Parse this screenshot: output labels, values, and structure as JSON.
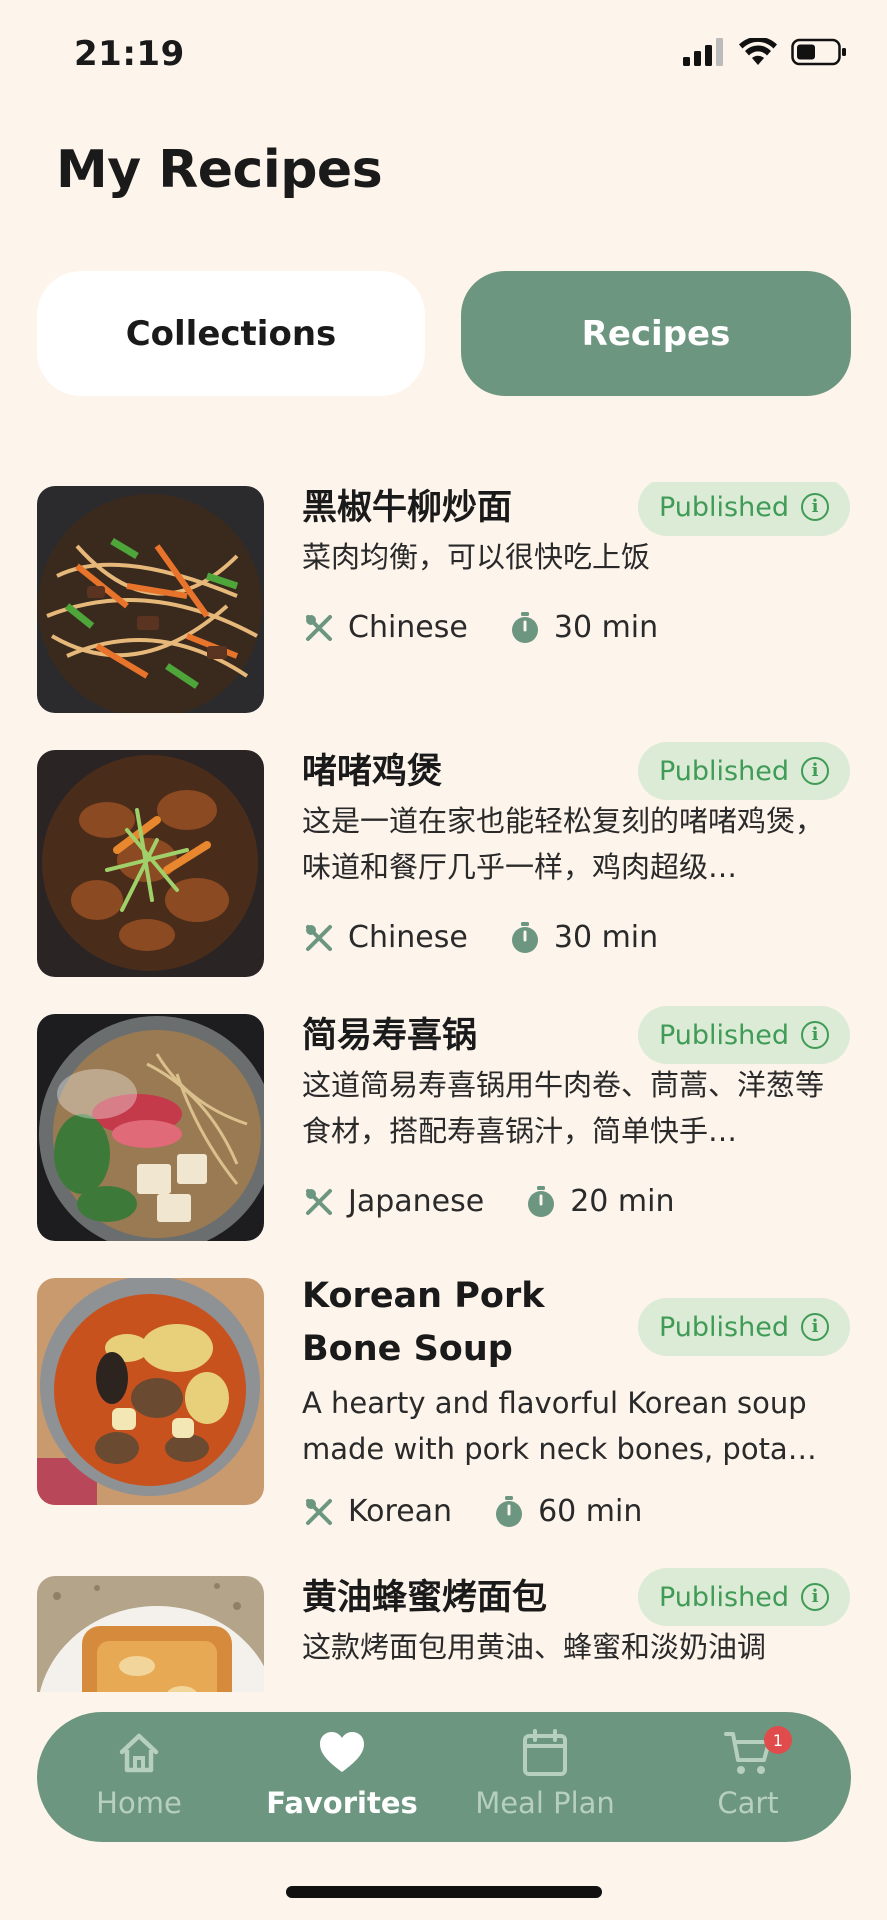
{
  "status_bar": {
    "time": "21:19"
  },
  "page": {
    "title": "My Recipes"
  },
  "tabs": [
    {
      "label": "Collections",
      "active": false
    },
    {
      "label": "Recipes",
      "active": true
    }
  ],
  "recipes": [
    {
      "title": "黑椒牛柳炒面",
      "status": "Published",
      "description": "菜肉均衡，可以很快吃上饭",
      "cuisine": "Chinese",
      "time": "30 min"
    },
    {
      "title": "啫啫鸡煲",
      "status": "Published",
      "description": "这是一道在家也能轻松复刻的啫啫鸡煲，味道和餐厅几乎一样，鸡肉超级…",
      "cuisine": "Chinese",
      "time": "30 min"
    },
    {
      "title": "简易寿喜锅",
      "status": "Published",
      "description": "这道简易寿喜锅用牛肉卷、茼蒿、洋葱等食材，搭配寿喜锅汁，简单快手…",
      "cuisine": "Japanese",
      "time": "20 min"
    },
    {
      "title": "Korean Pork Bone Soup",
      "status": "Published",
      "description": "A hearty and flavorful Korean soup made with pork neck bones, pota…",
      "cuisine": "Korean",
      "time": "60 min"
    },
    {
      "title": "黄油蜂蜜烤面包",
      "status": "Published",
      "description": "这款烤面包用黄油、蜂蜜和淡奶油调",
      "cuisine": "",
      "time": ""
    }
  ],
  "bottom_nav": [
    {
      "label": "Home",
      "icon": "home-icon",
      "active": false
    },
    {
      "label": "Favorites",
      "icon": "heart-icon",
      "active": true
    },
    {
      "label": "Meal Plan",
      "icon": "calendar-icon",
      "active": false
    },
    {
      "label": "Cart",
      "icon": "cart-icon",
      "active": false,
      "badge": "1"
    }
  ],
  "colors": {
    "background": "#fdf4ec",
    "accent": "#6c9680",
    "badge_bg": "#dcebd6",
    "badge_text": "#3f9b55",
    "cart_badge": "#e04b4b"
  }
}
